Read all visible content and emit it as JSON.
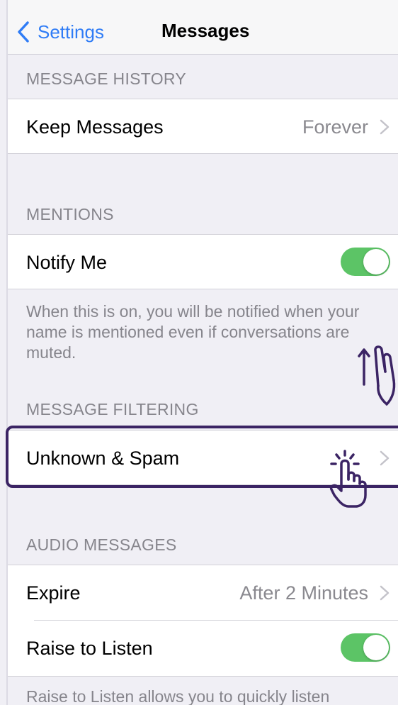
{
  "nav": {
    "back_label": "Settings",
    "title": "Messages"
  },
  "sections": {
    "message_history": {
      "header": "MESSAGE HISTORY",
      "keep_messages": {
        "label": "Keep Messages",
        "value": "Forever"
      }
    },
    "mentions": {
      "header": "MENTIONS",
      "notify_me": {
        "label": "Notify Me",
        "enabled": true
      },
      "footer": "When this is on, you will be notified when your name is mentioned even if conversations are muted."
    },
    "message_filtering": {
      "header": "MESSAGE FILTERING",
      "unknown_spam": {
        "label": "Unknown & Spam"
      }
    },
    "audio_messages": {
      "header": "AUDIO MESSAGES",
      "expire": {
        "label": "Expire",
        "value": "After 2 Minutes"
      },
      "raise_to_listen": {
        "label": "Raise to Listen",
        "enabled": true
      },
      "footer": "Raise to Listen allows you to quickly listen"
    }
  },
  "colors": {
    "accent_blue": "#2f7cf6",
    "toggle_on": "#5cc466",
    "highlight_outline": "#3b2464",
    "group_background": "#f0eff5"
  },
  "icons": {
    "back": "chevron-left-icon",
    "disclosure": "chevron-right-icon",
    "tap_gesture": "hand-tap-icon",
    "swipe_gesture": "hand-swipe-up-icon"
  }
}
